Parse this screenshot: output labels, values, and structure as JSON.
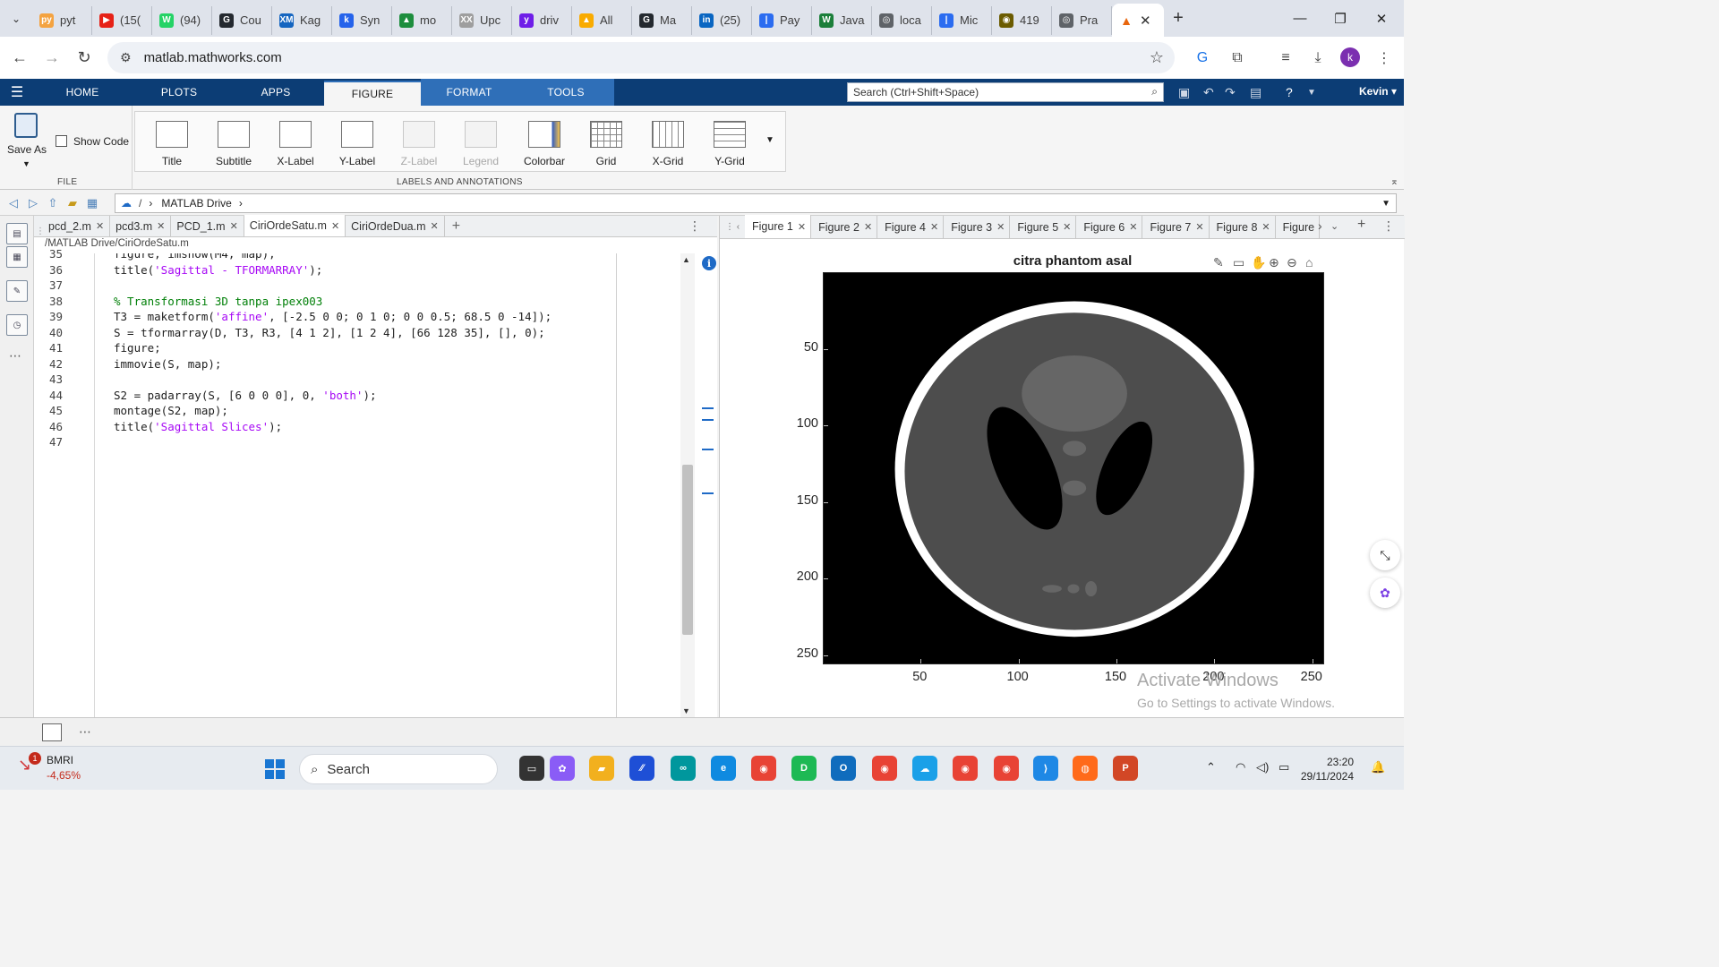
{
  "browser": {
    "tabs": [
      {
        "label": "pyt",
        "fav": "py",
        "color": "#f4a340"
      },
      {
        "label": "(15(",
        "fav": "▶",
        "color": "#e62117"
      },
      {
        "label": "(94)",
        "fav": "W",
        "color": "#25d366"
      },
      {
        "label": "Cou",
        "fav": "G",
        "color": "#24292f"
      },
      {
        "label": "Kag",
        "fav": "XM",
        "color": "#1565c0"
      },
      {
        "label": "Syn",
        "fav": "k",
        "color": "#2563eb"
      },
      {
        "label": "mo",
        "fav": "▲",
        "color": "#1e8e3e"
      },
      {
        "label": "Upc",
        "fav": "XX",
        "color": "#9e9e9e"
      },
      {
        "label": "driv",
        "fav": "y",
        "color": "#6f1ee8"
      },
      {
        "label": "All",
        "fav": "▲",
        "color": "#f9ab00"
      },
      {
        "label": "Ma",
        "fav": "G",
        "color": "#24292f"
      },
      {
        "label": "(25)",
        "fav": "in",
        "color": "#0a66c2"
      },
      {
        "label": "Pay",
        "fav": "|",
        "color": "#2b6cf0"
      },
      {
        "label": "Java",
        "fav": "W",
        "color": "#1b7f3a"
      },
      {
        "label": "loca",
        "fav": "◎",
        "color": "#5f6368"
      },
      {
        "label": "Mic",
        "fav": "|",
        "color": "#2b6cf0"
      },
      {
        "label": "419",
        "fav": "◉",
        "color": "#6b5b00"
      },
      {
        "label": "Pra",
        "fav": "◎",
        "color": "#5f6368"
      }
    ],
    "active_tab_icon": "matlab-icon",
    "url": "matlab.mathworks.com"
  },
  "matlab": {
    "tabs": [
      "HOME",
      "PLOTS",
      "APPS",
      "FIGURE",
      "FORMAT",
      "TOOLS"
    ],
    "search_placeholder": "Search (Ctrl+Shift+Space)",
    "user": "Kevin",
    "file_group": {
      "save_as": "Save As",
      "show_code": "Show Code",
      "title": "FILE"
    },
    "labels_group": {
      "title": "LABELS AND ANNOTATIONS",
      "buttons": [
        "Title",
        "Subtitle",
        "X-Label",
        "Y-Label",
        "Z-Label",
        "Legend",
        "Colorbar",
        "Grid",
        "X-Grid",
        "Y-Grid"
      ]
    },
    "path": {
      "root": "/",
      "folder": "MATLAB Drive"
    }
  },
  "editor": {
    "tabs": [
      {
        "label": "pcd_2.m"
      },
      {
        "label": "pcd3.m"
      },
      {
        "label": "PCD_1.m"
      },
      {
        "label": "CiriOrdeSatu.m"
      },
      {
        "label": "CiriOrdeDua.m"
      }
    ],
    "file_path": "/MATLAB Drive/CiriOrdeSatu.m",
    "lines": [
      {
        "n": "35",
        "t": "figure, imshow(M4, map);"
      },
      {
        "n": "36",
        "t": "title(",
        "s": "'Sagittal - TFORMARRAY'",
        "e": ");"
      },
      {
        "n": "37",
        "t": ""
      },
      {
        "n": "38",
        "c": "% Transformasi 3D tanpa ipex003"
      },
      {
        "n": "39",
        "t": "T3 = maketform(",
        "s": "'affine'",
        "e": ", [-2.5 0 0; 0 1 0; 0 0 0.5; 68.5 0 -14]);"
      },
      {
        "n": "40",
        "t": "S = tformarray(D, T3, R3, [4 1 2], [1 2 4], [66 128 35], [], 0);"
      },
      {
        "n": "41",
        "t": "figure;"
      },
      {
        "n": "42",
        "t": "immovie(S, map);"
      },
      {
        "n": "43",
        "t": ""
      },
      {
        "n": "44",
        "t": "S2 = padarray(S, [6 0 0 0], 0, ",
        "s": "'both'",
        "e": ");"
      },
      {
        "n": "45",
        "t": "montage(S2, map);"
      },
      {
        "n": "46",
        "t": "title(",
        "s": "'Sagittal Slices'",
        "e": ");"
      },
      {
        "n": "47",
        "t": ""
      }
    ]
  },
  "figure": {
    "tabs": [
      "Figure 1",
      "Figure 2",
      "Figure 4",
      "Figure 3",
      "Figure 5",
      "Figure 6",
      "Figure 7",
      "Figure 8",
      "Figure"
    ],
    "title": "citra phantom asal",
    "yticks": [
      "50",
      "100",
      "150",
      "200",
      "250"
    ],
    "xticks": [
      "50",
      "100",
      "150",
      "200",
      "250"
    ],
    "watermark": {
      "line1": "Activate Windows",
      "line2": "Go to Settings to activate Windows."
    }
  },
  "chart_data": {
    "type": "image",
    "title": "citra phantom asal",
    "xticks": [
      50,
      100,
      150,
      200,
      250
    ],
    "yticks": [
      50,
      100,
      150,
      200,
      250
    ],
    "xlim": [
      0.5,
      256.5
    ],
    "ylim": [
      0.5,
      256.5
    ],
    "y_direction": "reverse",
    "colormap": "gray"
  },
  "taskbar": {
    "stock": {
      "name": "BMRI",
      "change": "-4,65%",
      "badge": "1"
    },
    "search": "Search",
    "time": "23:20",
    "date": "29/11/2024"
  }
}
